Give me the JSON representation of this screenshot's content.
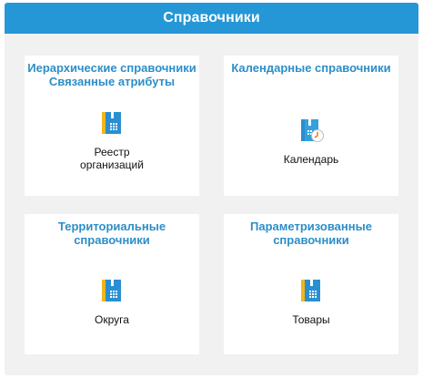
{
  "header": {
    "title": "Справочники"
  },
  "cards": [
    {
      "title_lines": [
        "Иерархические справочники",
        "Связанные атрибуты"
      ],
      "item": {
        "label_lines": [
          "Реестр",
          "организаций"
        ],
        "icon": "register-book-icon"
      }
    },
    {
      "title_lines": [
        "Календарные справочники"
      ],
      "item": {
        "label_lines": [
          "Календарь"
        ],
        "icon": "calendar-book-icon"
      }
    },
    {
      "title_lines": [
        "Территориальные",
        "справочники"
      ],
      "item": {
        "label_lines": [
          "Округа"
        ],
        "icon": "register-book-icon"
      }
    },
    {
      "title_lines": [
        "Параметризованные",
        "справочники"
      ],
      "item": {
        "label_lines": [
          "Товары"
        ],
        "icon": "register-book-icon"
      }
    }
  ],
  "colors": {
    "header_bg": "#2597d6",
    "title_text": "#2c8ec8",
    "icon_blue": "#2a8fd0",
    "icon_yellow": "#f2b51c"
  }
}
